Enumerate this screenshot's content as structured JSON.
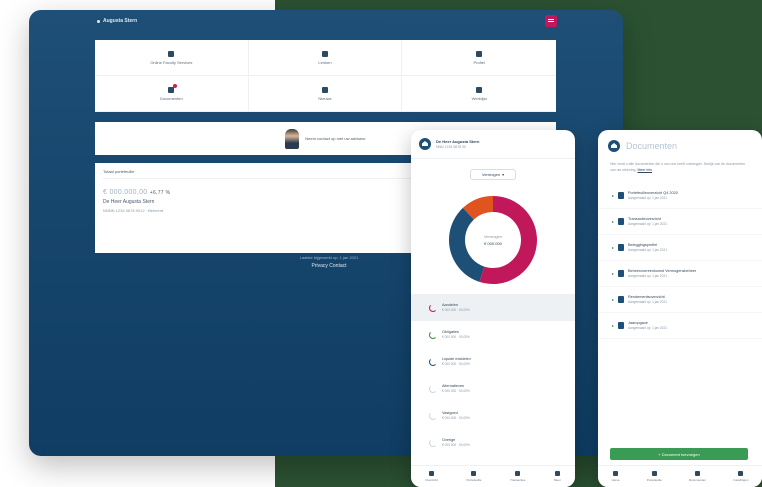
{
  "colors": {
    "navy": "#1e4f76",
    "green_bg": "#2b5132",
    "accent_red": "#c0185a",
    "button_green": "#3a9b54",
    "donut_orange": "#e0541f"
  },
  "dashboard": {
    "user_name": "Augusta Stern",
    "tiles": [
      {
        "label": "Online Faculty Services",
        "icon": "building-icon",
        "badge": false
      },
      {
        "label": "Lenken",
        "icon": "chat-icon",
        "badge": false
      },
      {
        "label": "Profiel",
        "icon": "user-icon",
        "badge": false
      },
      {
        "label": "Documenten",
        "icon": "document-icon",
        "badge": true
      },
      {
        "label": "Nieuws",
        "icon": "news-icon",
        "badge": false
      },
      {
        "label": "Werklijst",
        "icon": "list-icon",
        "badge": false
      }
    ],
    "contact_text": "Neem contact op met uw adviseur",
    "portfolio": {
      "title": "Totaal portefeuille",
      "amount": "€ 000.000,00",
      "change": "+6,77 %",
      "name": "De Heer Augusta Stern",
      "sub": "NNNN 1234 5678 9012 · Beheerd"
    },
    "footer_line1": "Laatste bijgewerkt op: 1 jan 2021",
    "footer_line2": "Privacy  Contact"
  },
  "phone1": {
    "header_title": "De Heer Augusta Stern",
    "header_sub": "NNN 1234 5678 90",
    "dropdown": "Vermogen",
    "donut": {
      "center_label": "Vermogen",
      "center_value": "€ 000.000",
      "segments": [
        {
          "value": 55,
          "color": "#c0185a"
        },
        {
          "value": 33,
          "color": "#1e4f76"
        },
        {
          "value": 12,
          "color": "#e0541f"
        }
      ]
    },
    "holdings": [
      {
        "name": "Aandelen",
        "value": "€ 000.000 · 00,00%",
        "color": "#c0185a",
        "selected": true
      },
      {
        "name": "Obligaties",
        "value": "€ 000.000 · 00,00%",
        "color": "#2f8b46",
        "selected": false
      },
      {
        "name": "Liquide middelen",
        "value": "€ 000.000 · 00,00%",
        "color": "#1e4f76",
        "selected": false
      },
      {
        "name": "Alternatieven",
        "value": "€ 000.000 · 00,00%",
        "color": "#cfd6dd",
        "selected": false
      },
      {
        "name": "Vastgoed",
        "value": "€ 000.000 · 00,00%",
        "color": "#cfd6dd",
        "selected": false
      },
      {
        "name": "Overige",
        "value": "€ 000.000 · 00,00%",
        "color": "#cfd6dd",
        "selected": false
      }
    ],
    "tabs": [
      {
        "label": "Overzicht",
        "icon": "home-icon"
      },
      {
        "label": "Portefeuille",
        "icon": "pie-icon"
      },
      {
        "label": "Transacties",
        "icon": "list-icon"
      },
      {
        "label": "Meer",
        "icon": "more-icon"
      }
    ]
  },
  "phone2": {
    "title": "Documenten",
    "intro": "Hier vindt u alle documenten die u van ons heeft ontvangen. Bekijk ook de documenten van uw rekening.",
    "intro_link": "Meer info",
    "documents": [
      {
        "name": "Portefeuilleoverzicht Q4 2020",
        "date": "Aangemaakt op: 1 jan 2021"
      },
      {
        "name": "Transactieoverzicht",
        "date": "Aangemaakt op: 1 jan 2021"
      },
      {
        "name": "Beleggingsprofiel",
        "date": "Aangemaakt op: 1 jan 2021"
      },
      {
        "name": "Beheerovereenkomst Vermogensbeheer",
        "date": "Aangemaakt op: 1 jan 2021"
      },
      {
        "name": "Rendementsoverzicht",
        "date": "Aangemaakt op: 1 jan 2021"
      },
      {
        "name": "Jaaropgave",
        "date": "Aangemaakt op: 1 jan 2021"
      }
    ],
    "button": "+ Document toevoegen",
    "tabs": [
      {
        "label": "Home",
        "icon": "home-icon"
      },
      {
        "label": "Portefeuille",
        "icon": "pie-icon"
      },
      {
        "label": "Documenten",
        "icon": "document-icon"
      },
      {
        "label": "Instellingen",
        "icon": "settings-icon"
      }
    ]
  }
}
